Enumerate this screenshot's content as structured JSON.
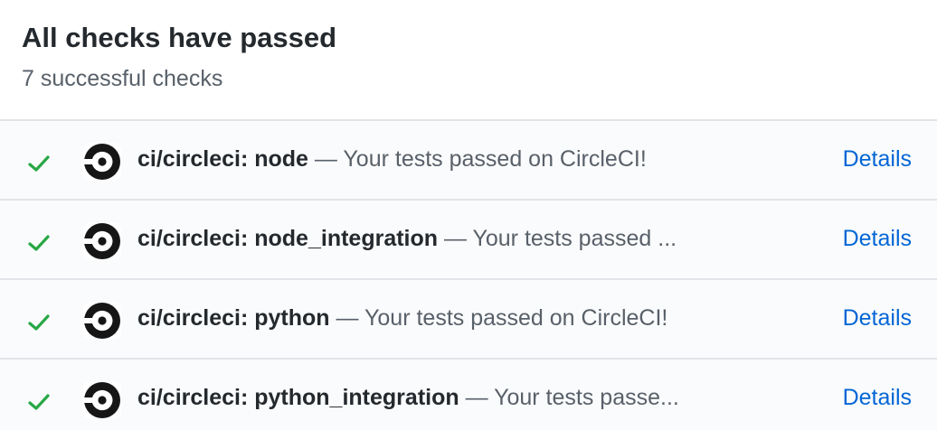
{
  "header": {
    "title": "All checks have passed",
    "subtitle": "7 successful checks"
  },
  "colors": {
    "success": "#28a745",
    "link": "#0366d6",
    "text_primary": "#24292e",
    "text_muted": "#586069"
  },
  "checks": [
    {
      "status_icon": "check-icon",
      "app_icon": "circleci-icon",
      "context": "ci/circleci: node",
      "separator": " — ",
      "description": "Your tests passed on CircleCI!",
      "details_label": "Details"
    },
    {
      "status_icon": "check-icon",
      "app_icon": "circleci-icon",
      "context": "ci/circleci: node_integration",
      "separator": " — ",
      "description": "Your tests passed ...",
      "details_label": "Details"
    },
    {
      "status_icon": "check-icon",
      "app_icon": "circleci-icon",
      "context": "ci/circleci: python",
      "separator": " — ",
      "description": "Your tests passed on CircleCI!",
      "details_label": "Details"
    },
    {
      "status_icon": "check-icon",
      "app_icon": "circleci-icon",
      "context": "ci/circleci: python_integration",
      "separator": " — ",
      "description": "Your tests passe...",
      "details_label": "Details"
    }
  ]
}
